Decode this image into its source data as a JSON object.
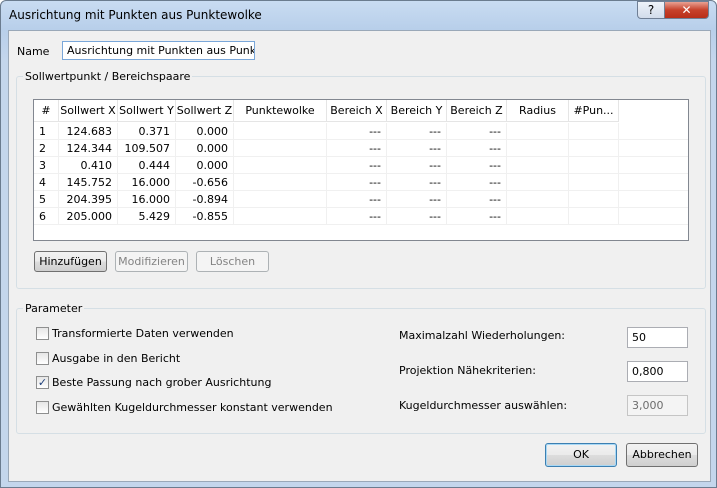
{
  "window": {
    "title": "Ausrichtung mit Punkten aus Punktewolke",
    "help_label": "?",
    "close_label": "✕"
  },
  "name": {
    "label": "Name",
    "value": "Ausrichtung mit Punkten aus Punktewolke"
  },
  "pairs_group": {
    "title": "Sollwertpunkt / Bereichspaare",
    "columns": [
      "#",
      "Sollwert X",
      "Sollwert Y",
      "Sollwert Z",
      "Punktewolke",
      "Bereich X",
      "Bereich Y",
      "Bereich Z",
      "Radius",
      "#Pun..."
    ],
    "rows": [
      [
        "1",
        "124.683",
        "0.371",
        "0.000",
        "",
        "---",
        "---",
        "---",
        "",
        ""
      ],
      [
        "2",
        "124.344",
        "109.507",
        "0.000",
        "",
        "---",
        "---",
        "---",
        "",
        ""
      ],
      [
        "3",
        "0.410",
        "0.444",
        "0.000",
        "",
        "---",
        "---",
        "---",
        "",
        ""
      ],
      [
        "4",
        "145.752",
        "16.000",
        "-0.656",
        "",
        "---",
        "---",
        "---",
        "",
        ""
      ],
      [
        "5",
        "204.395",
        "16.000",
        "-0.894",
        "",
        "---",
        "---",
        "---",
        "",
        ""
      ],
      [
        "6",
        "205.000",
        "5.429",
        "-0.855",
        "",
        "---",
        "---",
        "---",
        "",
        ""
      ]
    ],
    "add_label": "Hinzufügen",
    "modify_label": "Modifizieren",
    "delete_label": "Löschen"
  },
  "params": {
    "title": "Parameter",
    "checkboxes": [
      {
        "label": "Transformierte Daten verwenden",
        "checked": false
      },
      {
        "label": "Ausgabe in den Bericht",
        "checked": false
      },
      {
        "label": "Beste Passung nach grober Ausrichtung",
        "checked": true
      },
      {
        "label": "Gewählten Kugeldurchmesser konstant verwenden",
        "checked": false
      }
    ],
    "max_iter_label": "Maximalzahl Wiederholungen:",
    "max_iter_value": "50",
    "proj_label": "Projektion Nähekriterien:",
    "proj_value": "0,800",
    "sphere_label": "Kugeldurchmesser auswählen:",
    "sphere_value": "3,000"
  },
  "footer": {
    "ok_label": "OK",
    "cancel_label": "Abbrechen"
  }
}
